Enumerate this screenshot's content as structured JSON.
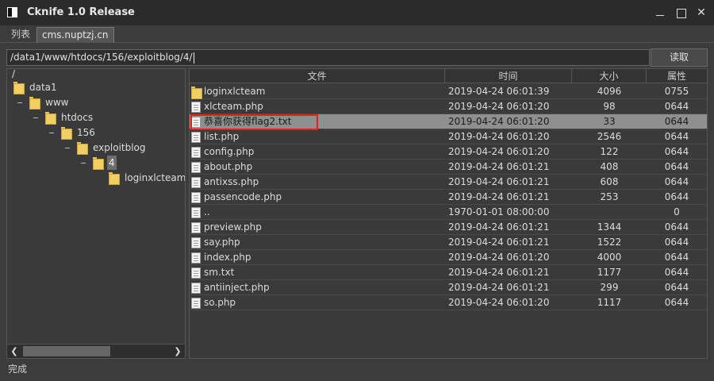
{
  "window": {
    "title": "Cknife 1.0 Release"
  },
  "tabs": [
    {
      "label": "列表"
    },
    {
      "label": "cms.nuptzj.cn"
    }
  ],
  "path": {
    "value": "/data1/www/htdocs/156/exploitblog/4/"
  },
  "read_button": {
    "label": "读取"
  },
  "tree": {
    "root": "/",
    "nodes": [
      {
        "label": "data1"
      },
      {
        "label": "www"
      },
      {
        "label": "htdocs"
      },
      {
        "label": "156"
      },
      {
        "label": "exploitblog"
      },
      {
        "label": "4"
      },
      {
        "label": "loginxlcteam"
      }
    ]
  },
  "file_table": {
    "headers": {
      "name": "文件",
      "time": "时间",
      "size": "大小",
      "attr": "属性"
    },
    "rows": [
      {
        "icon": "folder-icon",
        "name": "loginxlcteam",
        "time": "2019-04-24 06:01:39",
        "size": "4096",
        "attr": "0755"
      },
      {
        "icon": "file-icon",
        "name": "xlcteam.php",
        "time": "2019-04-24 06:01:20",
        "size": "98",
        "attr": "0644"
      },
      {
        "icon": "file-icon",
        "name": "恭喜你获得flag2.txt",
        "time": "2019-04-24 06:01:20",
        "size": "33",
        "attr": "0644"
      },
      {
        "icon": "file-icon",
        "name": "list.php",
        "time": "2019-04-24 06:01:20",
        "size": "2546",
        "attr": "0644"
      },
      {
        "icon": "file-icon",
        "name": "config.php",
        "time": "2019-04-24 06:01:20",
        "size": "122",
        "attr": "0644"
      },
      {
        "icon": "file-icon",
        "name": "about.php",
        "time": "2019-04-24 06:01:21",
        "size": "408",
        "attr": "0644"
      },
      {
        "icon": "file-icon",
        "name": "antixss.php",
        "time": "2019-04-24 06:01:21",
        "size": "608",
        "attr": "0644"
      },
      {
        "icon": "file-icon",
        "name": "passencode.php",
        "time": "2019-04-24 06:01:21",
        "size": "253",
        "attr": "0644"
      },
      {
        "icon": "file-icon",
        "name": "..",
        "time": "1970-01-01 08:00:00",
        "size": "",
        "attr": "0"
      },
      {
        "icon": "file-icon",
        "name": "preview.php",
        "time": "2019-04-24 06:01:21",
        "size": "1344",
        "attr": "0644"
      },
      {
        "icon": "file-icon",
        "name": "say.php",
        "time": "2019-04-24 06:01:21",
        "size": "1522",
        "attr": "0644"
      },
      {
        "icon": "file-icon",
        "name": "index.php",
        "time": "2019-04-24 06:01:20",
        "size": "4000",
        "attr": "0644"
      },
      {
        "icon": "file-icon",
        "name": "sm.txt",
        "time": "2019-04-24 06:01:21",
        "size": "1177",
        "attr": "0644"
      },
      {
        "icon": "file-icon",
        "name": "antiinject.php",
        "time": "2019-04-24 06:01:21",
        "size": "299",
        "attr": "0644"
      },
      {
        "icon": "file-icon",
        "name": "so.php",
        "time": "2019-04-24 06:01:20",
        "size": "1117",
        "attr": "0644"
      }
    ]
  },
  "status": {
    "text": "完成"
  },
  "colors": {
    "highlight_border": "#e02020",
    "selected_row": "#8f8f8f"
  }
}
